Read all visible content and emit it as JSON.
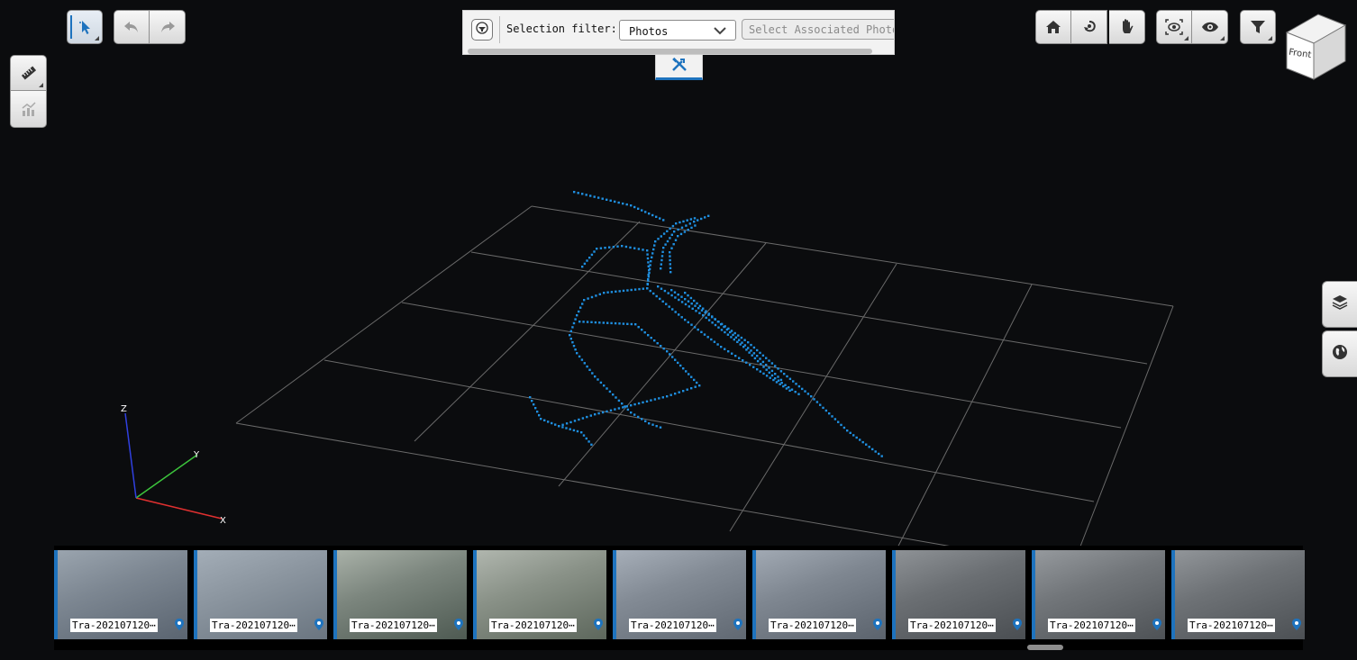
{
  "toolbar_left": {
    "select_tool": "select-pointer-icon",
    "undo": "undo-icon",
    "redo": "redo-icon",
    "measure": "ruler-icon",
    "profile": "profile-chart-icon"
  },
  "selection_filter": {
    "label": "Selection filter:",
    "value": "Photos",
    "associate_button": "Select Associated Photos"
  },
  "toolbar_right": {
    "home": "home-icon",
    "orbit": "orbit-icon",
    "pan": "hand-icon",
    "focus": "focus-eye-icon",
    "visibility": "eye-icon",
    "filter": "filter-funnel-icon"
  },
  "viewcube": {
    "face_label": "Front"
  },
  "axes": {
    "x": "X",
    "y": "Y",
    "z": "Z"
  },
  "side_tabs": [
    "layers-icon",
    "globe-icon"
  ],
  "photos": [
    {
      "label": "Tra-202107120⋯"
    },
    {
      "label": "Tra-202107120⋯"
    },
    {
      "label": "Tra-202107120⋯"
    },
    {
      "label": "Tra-202107120⋯"
    },
    {
      "label": "Tra-202107120⋯"
    },
    {
      "label": "Tra-202107120⋯"
    },
    {
      "label": "Tra-202107120⋯"
    },
    {
      "label": "Tra-202107120⋯"
    },
    {
      "label": "Tra-202107120⋯"
    }
  ],
  "colors": {
    "background": "#0b0c0e",
    "grid": "#6a6a6a",
    "points": "#1f8fe0",
    "accent": "#1e73be",
    "axis_x": "#e03030",
    "axis_y": "#3cc43c",
    "axis_z": "#3040e0"
  }
}
